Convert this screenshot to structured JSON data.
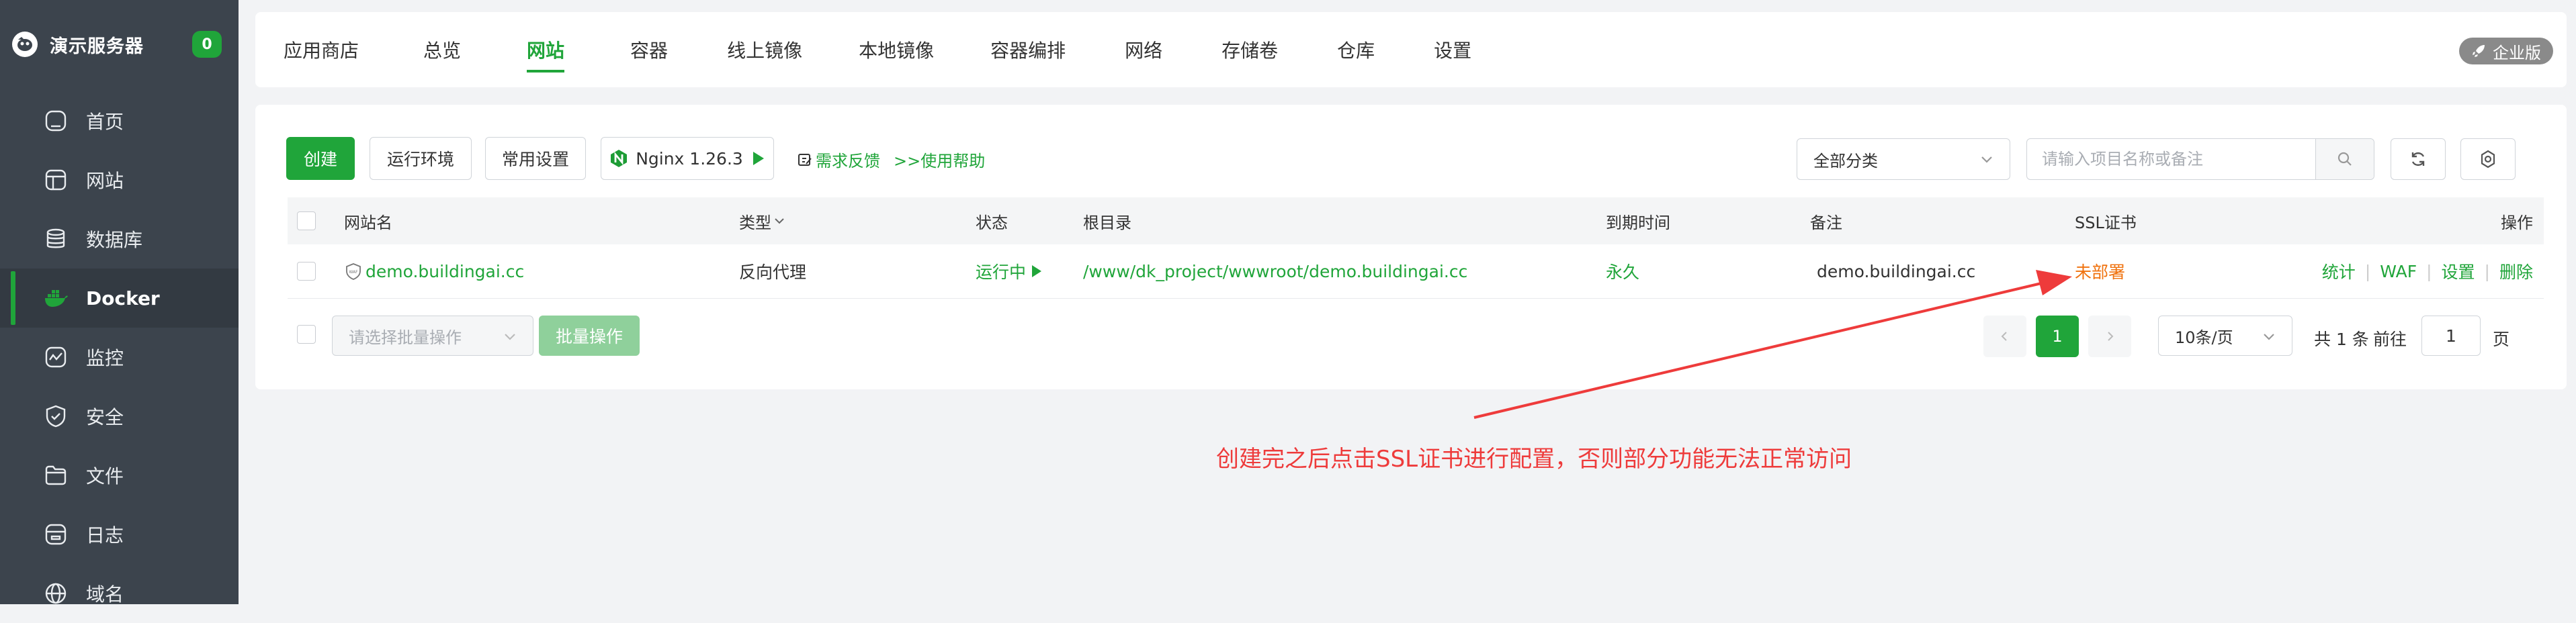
{
  "sidebar": {
    "server_name": "演示服务器",
    "badge": "0",
    "items": [
      {
        "label": "首页",
        "icon": "home-icon"
      },
      {
        "label": "网站",
        "icon": "website-icon"
      },
      {
        "label": "数据库",
        "icon": "database-icon"
      },
      {
        "label": "Docker",
        "icon": "docker-icon"
      },
      {
        "label": "监控",
        "icon": "monitor-icon"
      },
      {
        "label": "安全",
        "icon": "shield-icon"
      },
      {
        "label": "文件",
        "icon": "folder-icon"
      },
      {
        "label": "日志",
        "icon": "log-icon"
      },
      {
        "label": "域名",
        "icon": "globe-icon"
      }
    ]
  },
  "tabs": [
    "应用商店",
    "总览",
    "网站",
    "容器",
    "线上镜像",
    "本地镜像",
    "容器编排",
    "网络",
    "存储卷",
    "仓库",
    "设置"
  ],
  "active_tab": "网站",
  "enterprise_label": "企业版",
  "toolbar": {
    "create": "创建",
    "runtime": "运行环境",
    "common_settings": "常用设置",
    "nginx": "Nginx 1.26.3",
    "feedback": "需求反馈",
    "help": ">>使用帮助",
    "category": "全部分类",
    "search_placeholder": "请输入项目名称或备注"
  },
  "table": {
    "headers": {
      "name": "网站名",
      "type": "类型",
      "status": "状态",
      "root": "根目录",
      "expire": "到期时间",
      "remark": "备注",
      "ssl": "SSL证书",
      "actions": "操作"
    },
    "rows": [
      {
        "name": "demo.buildingai.cc",
        "type": "反向代理",
        "status": "运行中",
        "root": "/www/dk_project/wwwroot/demo.buildingai.cc",
        "expire": "永久",
        "remark": "demo.buildingai.cc",
        "ssl": "未部署",
        "actions": [
          "统计",
          "WAF",
          "设置",
          "删除"
        ]
      }
    ]
  },
  "footer": {
    "batch_placeholder": "请选择批量操作",
    "batch_button": "批量操作",
    "current_page": "1",
    "page_size": "10条/页",
    "total": "共 1 条",
    "goto": "前往",
    "goto_value": "1",
    "page_unit": "页"
  },
  "annotation": "创建完之后点击SSL证书进行配置，否则部分功能无法正常访问",
  "colors": {
    "accent": "#20a53a",
    "sidebar": "#3c444d",
    "warning": "#f0720e",
    "annotation": "#ee3b3b"
  }
}
